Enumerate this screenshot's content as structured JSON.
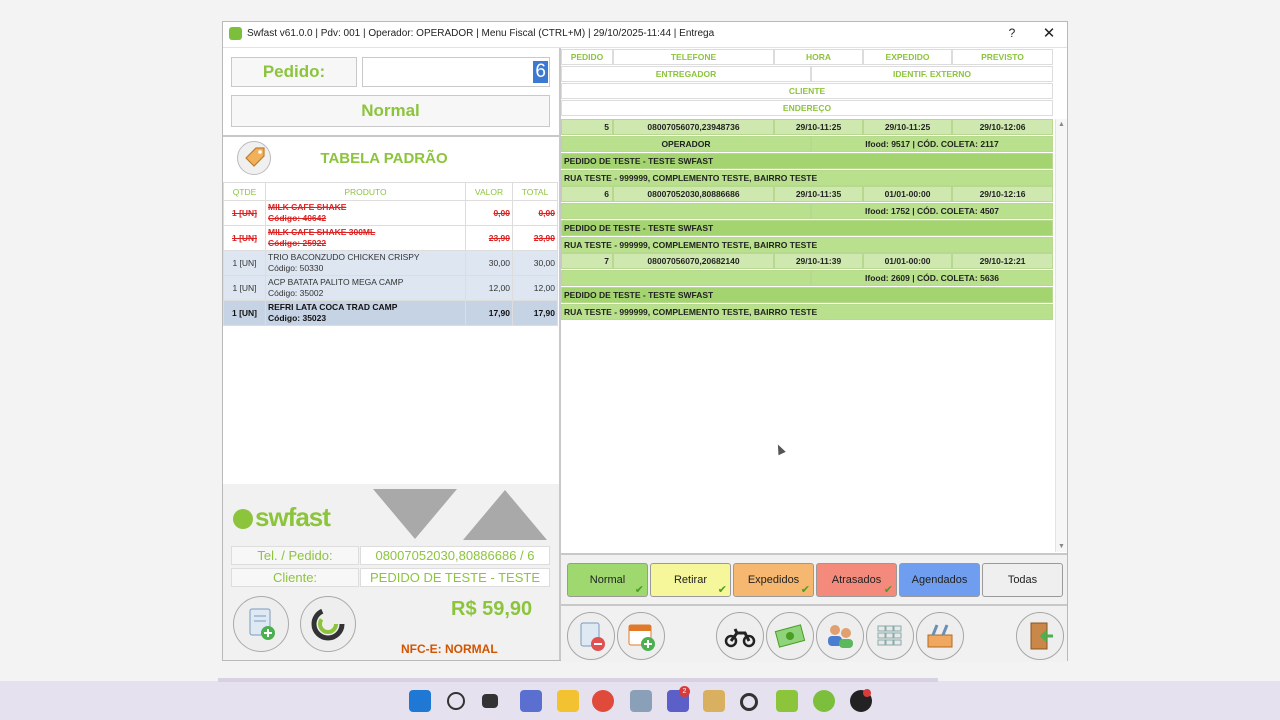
{
  "window": {
    "title": "Swfast v61.0.0 | Pdv: 001 | Operador: OPERADOR | Menu Fiscal (CTRL+M) | 29/10/2025-11:44 | Entrega",
    "help_label": "?",
    "close_label": "✕"
  },
  "left": {
    "pedido_label": "Pedido:",
    "pedido_value": "6",
    "mode": "Normal",
    "tabela": "TABELA PADRÃO",
    "columns": [
      "QTDE",
      "PRODUTO",
      "VALOR",
      "TOTAL"
    ],
    "items": [
      {
        "qtde": "1 [UN]",
        "produto": "MILK CAFE SHAKE",
        "codigo": "Código: 40642",
        "valor": "0,00",
        "total": "0,00",
        "status": "cancelled"
      },
      {
        "qtde": "1 [UN]",
        "produto": "MILK CAFE SHAKE 300ML",
        "codigo": "Código: 25922",
        "valor": "23,90",
        "total": "23,90",
        "status": "cancelled"
      },
      {
        "qtde": "1 [UN]",
        "produto": "TRIO BACONZUDO CHICKEN CRISPY",
        "codigo": "Código: 50330",
        "valor": "30,00",
        "total": "30,00",
        "status": "normal"
      },
      {
        "qtde": "1 [UN]",
        "produto": "ACP BATATA PALITO MEGA CAMP",
        "codigo": "Código: 35002",
        "valor": "12,00",
        "total": "12,00",
        "status": "normal"
      },
      {
        "qtde": "1 [UN]",
        "produto": "REFRI LATA COCA TRAD CAMP",
        "codigo": "Código: 35023",
        "valor": "17,90",
        "total": "17,90",
        "status": "selected"
      }
    ],
    "logo_text": "swfast",
    "tel_label": "Tel. / Pedido:",
    "tel_value": "08007052030,80886686 / 6",
    "cliente_label": "Cliente:",
    "cliente_value": "PEDIDO DE TESTE - TESTE",
    "total": "R$ 59,90",
    "nfce": "NFC-E: NORMAL"
  },
  "right": {
    "headers": {
      "pedido": "PEDIDO",
      "telefone": "TELEFONE",
      "hora": "HORA",
      "expedido": "EXPEDIDO",
      "previsto": "PREVISTO",
      "entregador": "ENTREGADOR",
      "identif": "IDENTIF. EXTERNO",
      "cliente": "CLIENTE",
      "endereco": "ENDEREÇO"
    },
    "orders": [
      {
        "pedido": "5",
        "telefone": "08007056070,23948736",
        "hora": "29/10-11:25",
        "expedido": "29/10-11:25",
        "previsto": "29/10-12:06",
        "entregador": "OPERADOR",
        "identif": "Ifood: 9517 | CÓD. COLETA: 2117",
        "cliente": "PEDIDO DE TESTE - TESTE SWFAST",
        "endereco": "RUA TESTE - 999999, COMPLEMENTO TESTE, BAIRRO TESTE"
      },
      {
        "pedido": "6",
        "telefone": "08007052030,80886686",
        "hora": "29/10-11:35",
        "expedido": "01/01-00:00",
        "previsto": "29/10-12:16",
        "entregador": "",
        "identif": "Ifood: 1752 | CÓD. COLETA: 4507",
        "cliente": "PEDIDO DE TESTE - TESTE SWFAST",
        "endereco": "RUA TESTE - 999999, COMPLEMENTO TESTE, BAIRRO TESTE"
      },
      {
        "pedido": "7",
        "telefone": "08007056070,20682140",
        "hora": "29/10-11:39",
        "expedido": "01/01-00:00",
        "previsto": "29/10-12:21",
        "entregador": "",
        "identif": "Ifood: 2609 | CÓD. COLETA: 5636",
        "cliente": "PEDIDO DE TESTE - TESTE SWFAST",
        "endereco": "RUA TESTE - 999999, COMPLEMENTO TESTE, BAIRRO TESTE"
      }
    ],
    "filters": [
      {
        "label": "Normal",
        "color": "#9fd86e",
        "checked": true
      },
      {
        "label": "Retirar",
        "color": "#f6f79a",
        "checked": true
      },
      {
        "label": "Expedidos",
        "color": "#f6b871",
        "checked": true
      },
      {
        "label": "Atrasados",
        "color": "#f48a7c",
        "checked": true
      },
      {
        "label": "Agendados",
        "color": "#6f9ef0",
        "checked": false
      },
      {
        "label": "Todas",
        "color": "#efefef",
        "checked": false
      }
    ]
  },
  "colors": {
    "accent": "#8cc43c",
    "row_green": "#b9e08c",
    "row_green_dark": "#a4d470",
    "cancel": "#d22222"
  },
  "taskbar": {
    "teams_badge": "2"
  }
}
